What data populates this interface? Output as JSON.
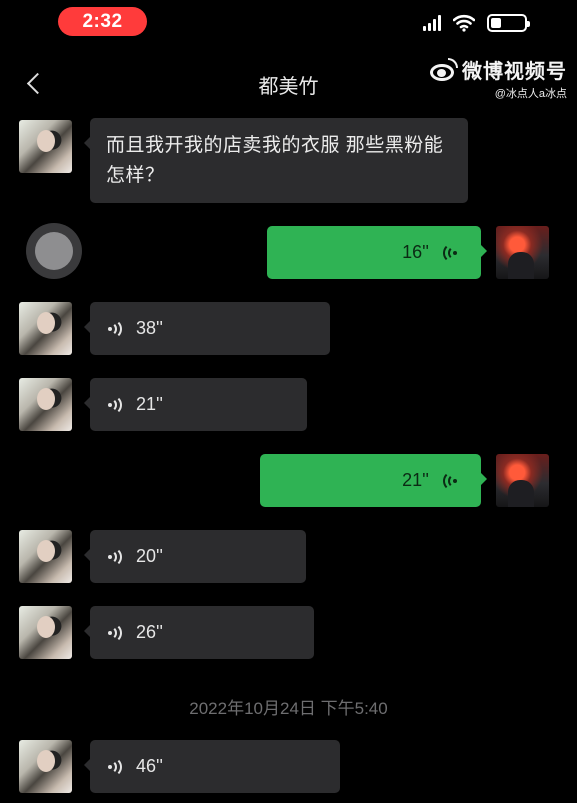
{
  "status_bar": {
    "time": "2:32"
  },
  "header": {
    "back_icon": "chevron-left-icon",
    "contact_name": "都美竹"
  },
  "watermark": {
    "platform": "微博视频号",
    "handle": "@冰点人a冰点"
  },
  "messages": [
    {
      "type": "text",
      "direction": "in",
      "text": "而且我开我的店卖我的衣服 那些黑粉能怎样？"
    },
    {
      "type": "voice",
      "direction": "out",
      "duration": "16''"
    },
    {
      "type": "voice",
      "direction": "in",
      "duration": "38''"
    },
    {
      "type": "voice",
      "direction": "in",
      "duration": "21''"
    },
    {
      "type": "voice",
      "direction": "out",
      "duration": "21''"
    },
    {
      "type": "voice",
      "direction": "in",
      "duration": "20''"
    },
    {
      "type": "voice",
      "direction": "in",
      "duration": "26''"
    },
    {
      "type": "timestamp",
      "text": "2022年10月24日 下午5:40"
    },
    {
      "type": "voice",
      "direction": "in",
      "duration": "46''"
    }
  ],
  "colors": {
    "outgoing_bubble": "#2fb354",
    "incoming_bubble": "#2c2c2e",
    "time_pill": "#ff3b3b",
    "background": "#000000"
  }
}
